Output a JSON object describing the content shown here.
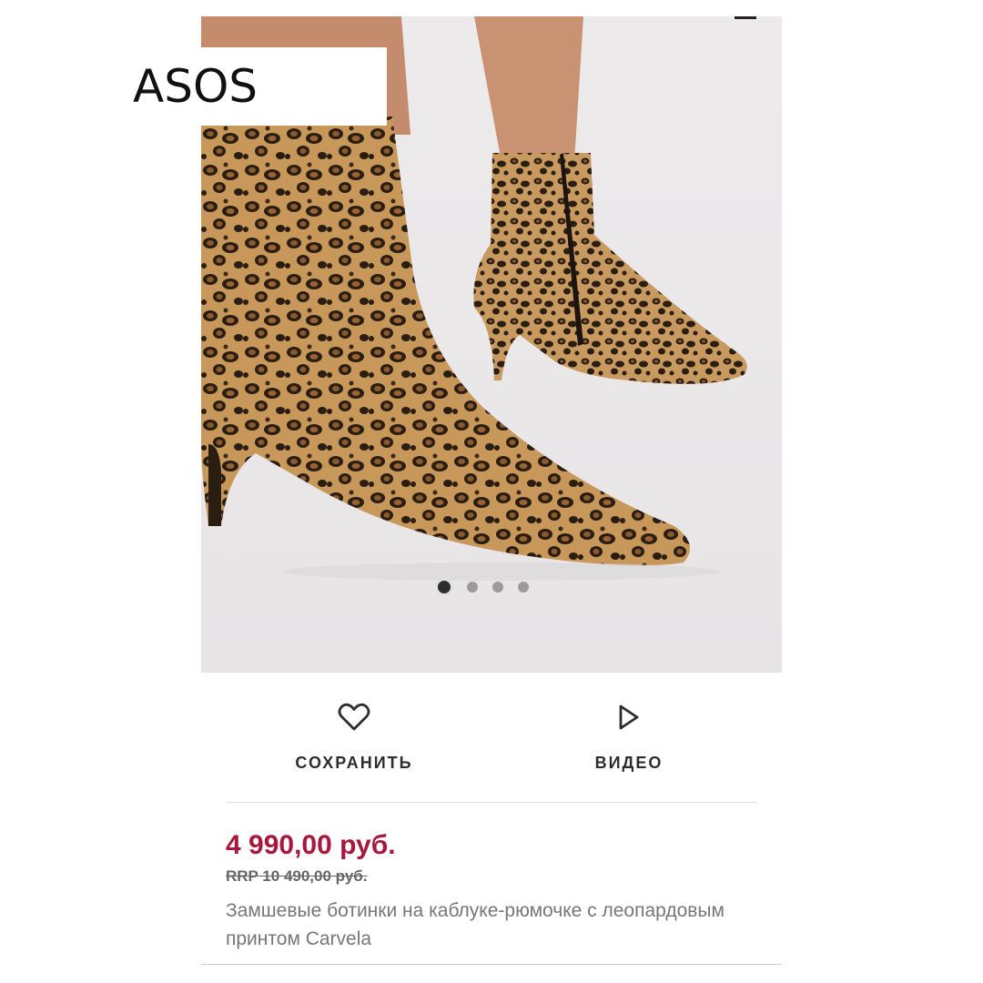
{
  "brand": {
    "name": "ASOS"
  },
  "gallery": {
    "image_alt": "Leopard print suede kitten heel ankle boots",
    "dots": [
      true,
      false,
      false,
      false
    ]
  },
  "actions": {
    "save_label": "СОХРАНИТЬ",
    "video_label": "ВИДЕО"
  },
  "product": {
    "price": "4 990,00 руб.",
    "rrp": "RRP 10 490,00 руб.",
    "title": "Замшевые ботинки на каблуке-рюмочке с леопардовым принтом Carvela"
  },
  "colors": {
    "price": "#a8173c",
    "text": "#2d2d2d",
    "muted": "#777777"
  },
  "icons": [
    "heart-icon",
    "play-icon",
    "menu-icon"
  ]
}
